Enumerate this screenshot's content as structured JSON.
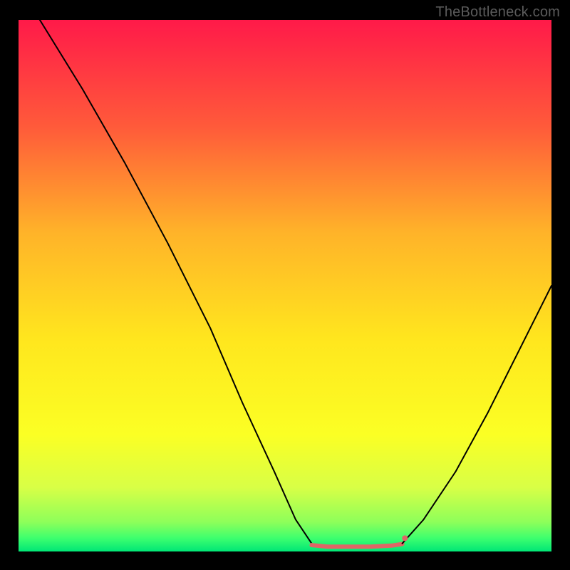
{
  "watermark": "TheBottleneck.com",
  "chart_data": {
    "type": "line",
    "title": "",
    "xlabel": "",
    "ylabel": "",
    "xlim": [
      0,
      100
    ],
    "ylim": [
      0,
      100
    ],
    "grid": false,
    "legend": false,
    "background_gradient_stops": [
      {
        "offset": 0.0,
        "color": "#ff1a49"
      },
      {
        "offset": 0.2,
        "color": "#ff5a3a"
      },
      {
        "offset": 0.4,
        "color": "#ffb329"
      },
      {
        "offset": 0.6,
        "color": "#ffe61e"
      },
      {
        "offset": 0.78,
        "color": "#fbff24"
      },
      {
        "offset": 0.88,
        "color": "#d8ff46"
      },
      {
        "offset": 0.945,
        "color": "#8dff5a"
      },
      {
        "offset": 0.975,
        "color": "#3dff6e"
      },
      {
        "offset": 1.0,
        "color": "#00e676"
      }
    ],
    "series": [
      {
        "name": "left-curve",
        "color": "#000000",
        "width": 2,
        "points": [
          {
            "x": 4,
            "y": 100
          },
          {
            "x": 12,
            "y": 87
          },
          {
            "x": 20,
            "y": 73
          },
          {
            "x": 28,
            "y": 58
          },
          {
            "x": 36,
            "y": 42
          },
          {
            "x": 42,
            "y": 28
          },
          {
            "x": 48,
            "y": 15
          },
          {
            "x": 52,
            "y": 6
          },
          {
            "x": 55,
            "y": 1.5
          }
        ]
      },
      {
        "name": "bottom-flat",
        "color": "#e06666",
        "width": 6,
        "points": [
          {
            "x": 55,
            "y": 1.2
          },
          {
            "x": 58,
            "y": 0.9
          },
          {
            "x": 62,
            "y": 0.9
          },
          {
            "x": 66,
            "y": 0.9
          },
          {
            "x": 70,
            "y": 1.1
          },
          {
            "x": 72,
            "y": 1.4
          }
        ]
      },
      {
        "name": "right-curve",
        "color": "#000000",
        "width": 2,
        "points": [
          {
            "x": 72,
            "y": 1.5
          },
          {
            "x": 76,
            "y": 6
          },
          {
            "x": 82,
            "y": 15
          },
          {
            "x": 88,
            "y": 26
          },
          {
            "x": 94,
            "y": 38
          },
          {
            "x": 100,
            "y": 50
          }
        ]
      }
    ],
    "marker": {
      "x": 72.5,
      "y": 2.5,
      "r": 4,
      "color": "#e06666"
    }
  }
}
